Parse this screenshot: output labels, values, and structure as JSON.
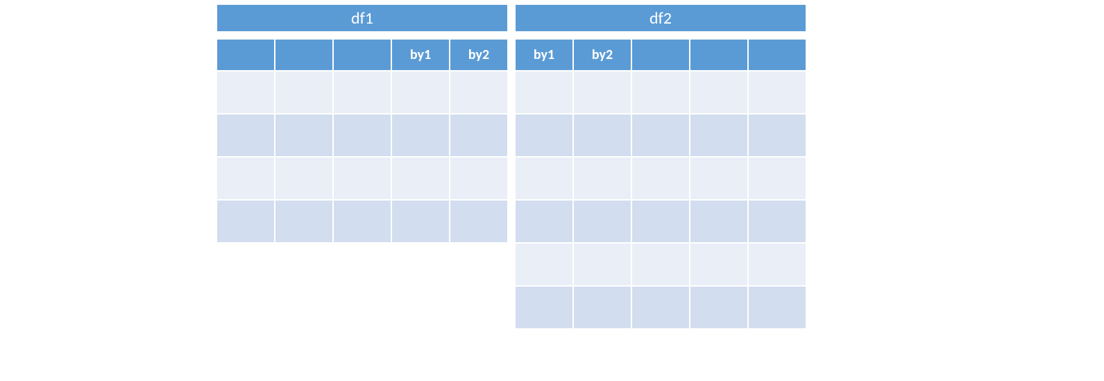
{
  "colors": {
    "header": "#5b9bd5",
    "light": "#e9eef7",
    "dark": "#d2deef"
  },
  "df1": {
    "title": "df1",
    "cols": 5,
    "rows": 4,
    "headers": [
      "",
      "",
      "",
      "by1",
      "by2"
    ]
  },
  "df2": {
    "title": "df2",
    "cols": 5,
    "rows": 6,
    "headers": [
      "by1",
      "by2",
      "",
      "",
      ""
    ]
  }
}
